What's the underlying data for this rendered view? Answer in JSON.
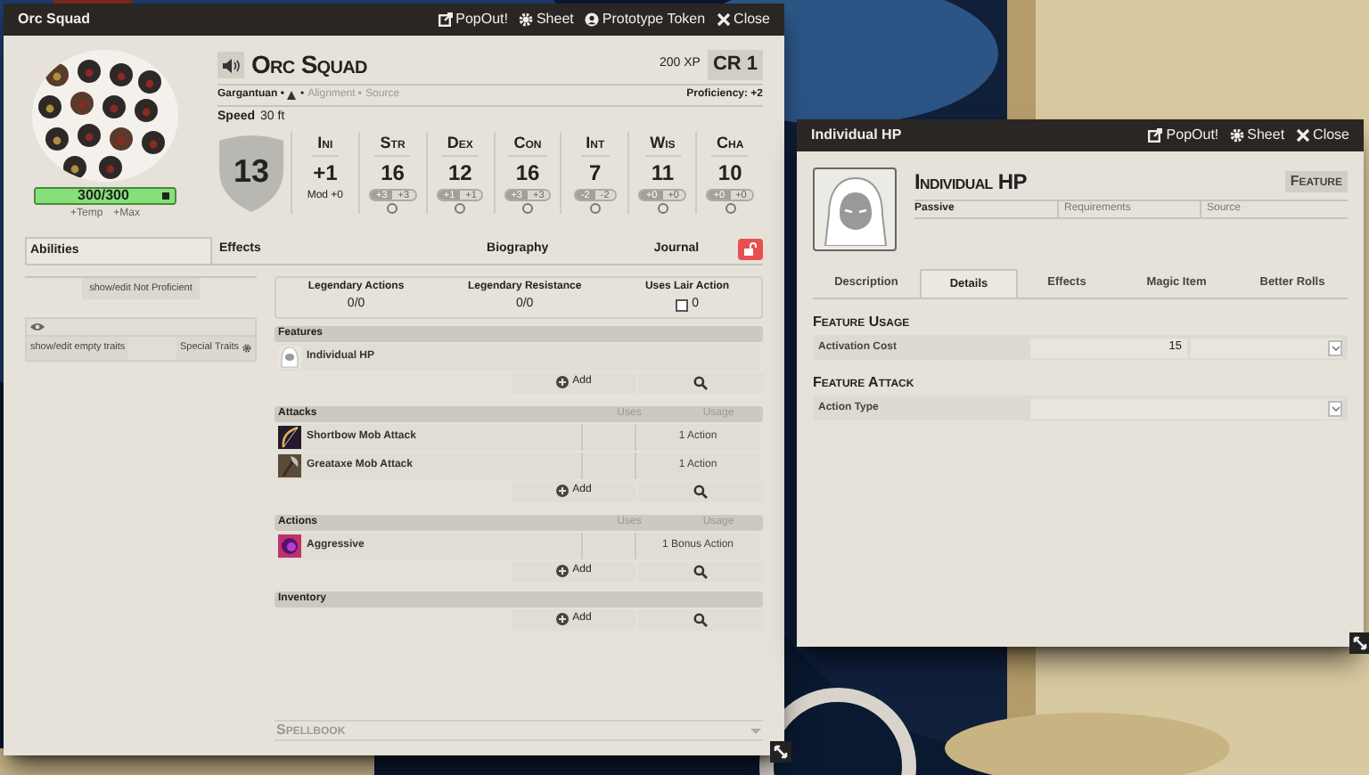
{
  "main_window": {
    "title": "Orc Squad",
    "header_buttons": [
      {
        "kind": "popout",
        "label": "PopOut!"
      },
      {
        "kind": "sheet",
        "label": "Sheet"
      },
      {
        "kind": "token",
        "label": "Prototype Token"
      },
      {
        "kind": "close",
        "label": "Close"
      }
    ],
    "name": "Orc Squad",
    "xp": "200 XP",
    "cr": "CR 1",
    "hp": {
      "value": "300/300",
      "level": 1,
      "temp": "+Temp",
      "max": "+Max"
    },
    "details": {
      "size": "Gargantuan •",
      "type_sep": "•",
      "alignment": "Alignment •",
      "source": "Source",
      "proficiency": "Proficiency: +2"
    },
    "speed": {
      "label": "Speed",
      "value": "30 ft"
    },
    "ac": "13",
    "initiative": {
      "label": "Ini",
      "value": "+1",
      "mod": "Mod +0"
    },
    "abilities": [
      {
        "label": "Str",
        "score": "16",
        "mod": "+3",
        "save": "+3",
        "proficient": false
      },
      {
        "label": "Dex",
        "score": "12",
        "mod": "+1",
        "save": "+1",
        "proficient": false
      },
      {
        "label": "Con",
        "score": "16",
        "mod": "+3",
        "save": "+3",
        "proficient": false
      },
      {
        "label": "Int",
        "score": "7",
        "mod": "-2",
        "save": "-2",
        "proficient": false
      },
      {
        "label": "Wis",
        "score": "11",
        "mod": "+0",
        "save": "+0",
        "proficient": false
      },
      {
        "label": "Cha",
        "score": "10",
        "mod": "+0",
        "save": "+0",
        "proficient": false
      }
    ],
    "tabs": [
      {
        "label": "Abilities",
        "selected": true
      },
      {
        "label": "Effects",
        "selected": false
      },
      {
        "label": "Biography",
        "selected": false
      },
      {
        "label": "Journal",
        "selected": false
      }
    ],
    "left_buttons": {
      "not_proficient": "show/edit Not Proficient",
      "empty_traits": "show/edit empty traits",
      "special_traits": "Special Traits"
    },
    "legendary": [
      {
        "label": "Legendary Actions",
        "value": "0/0"
      },
      {
        "label": "Legendary Resistance",
        "value": "0/0"
      }
    ],
    "lair": {
      "label": "Uses Lair Action",
      "checked": false,
      "value": "0"
    },
    "sections": [
      {
        "title": "Features",
        "items": [
          {
            "name": "Individual HP"
          }
        ],
        "add": "Add"
      },
      {
        "title": "Attacks",
        "columns": [
          "Uses",
          "Usage"
        ],
        "items": [
          {
            "name": "Shortbow Mob Attack",
            "usage": "1 Action"
          },
          {
            "name": "Greataxe Mob Attack",
            "usage": "1 Action"
          }
        ],
        "add": "Add"
      },
      {
        "title": "Actions",
        "columns": [
          "Uses",
          "Usage"
        ],
        "items": [
          {
            "name": "Aggressive",
            "usage": "1 Bonus Action"
          }
        ],
        "add": "Add"
      },
      {
        "title": "Inventory",
        "add": "Add"
      }
    ],
    "spellbook": "Spellbook"
  },
  "item_window": {
    "title": "Individual HP",
    "header_buttons": [
      {
        "kind": "popout",
        "label": "PopOut!"
      },
      {
        "kind": "sheet",
        "label": "Sheet"
      },
      {
        "kind": "close",
        "label": "Close"
      }
    ],
    "name": "Individual HP",
    "type": "Feature",
    "activation": "Passive",
    "requirements": "Requirements",
    "source": "Source",
    "tabs": [
      {
        "label": "Description",
        "selected": false
      },
      {
        "label": "Details",
        "selected": true
      },
      {
        "label": "Effects",
        "selected": false
      },
      {
        "label": "Magic Item",
        "selected": false
      },
      {
        "label": "Better Rolls",
        "selected": false
      }
    ],
    "sections": [
      {
        "title": "Feature Usage",
        "fields": [
          {
            "kind": "cost",
            "label": "Activation Cost",
            "value": "15"
          }
        ]
      },
      {
        "title": "Feature Attack",
        "fields": [
          {
            "kind": "select",
            "label": "Action Type"
          }
        ]
      }
    ]
  }
}
